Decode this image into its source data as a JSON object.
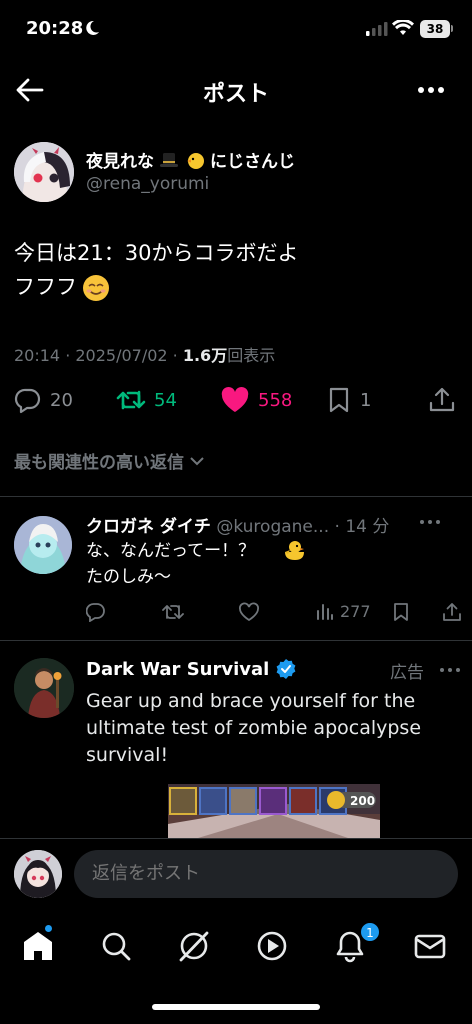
{
  "status_bar": {
    "time": "20:28",
    "battery": "38"
  },
  "header": {
    "title": "ポスト"
  },
  "post": {
    "author_name": "夜見れな",
    "author_name_suffix": "にじさんじ",
    "author_handle": "@rena_yorumi",
    "text": "今日は21：30からコラボだよ\nフフフ",
    "time": "20:14 · 2025/07/02 · ",
    "views": "1.6万",
    "views_label": "回表示",
    "replies": "20",
    "reposts": "54",
    "likes": "558",
    "bookmarks": "1",
    "colors": {
      "repost": "#00ba7c",
      "like": "#f91880"
    }
  },
  "sort": {
    "label": "最も関連性の高い返信"
  },
  "reply": {
    "name": "クロガネ ダイチ",
    "handle": "@kurogane...",
    "time": " · 14 分",
    "text": "な、なんだってー！？\nたのしみ〜",
    "views": "277"
  },
  "ad": {
    "name": "Dark War Survival",
    "label": "広告",
    "text": "Gear up and brace yourself for the ultimate test of zombie apocalypse survival!",
    "coin_count": "200"
  },
  "compose": {
    "placeholder": "返信をポスト"
  },
  "tabs": {
    "notifications_badge": "1"
  },
  "icons": [
    "back-arrow-icon",
    "more-icon",
    "reply-icon",
    "repost-icon",
    "heart-icon",
    "bookmark-icon",
    "share-icon",
    "chevron-down-icon",
    "verified-icon",
    "home-icon",
    "search-icon",
    "grok-icon",
    "spaces-icon",
    "bell-icon",
    "mail-icon"
  ]
}
